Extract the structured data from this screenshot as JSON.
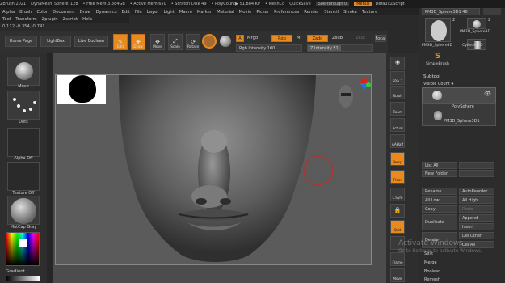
{
  "titlebar": {
    "app": "ZBrush 2021",
    "doc": "DynaMesh_Sphere_128",
    "free_mem": "• Free Mem 3.384GB",
    "active_mem": "• Active Mem 650",
    "scratch": "• Scratch Disk 49",
    "timer": "• PolyCount▶ 51.884 KP",
    "meshcount": "• MeshCo",
    "quicksave": "QuickSave",
    "see_through": "See-through  0",
    "menus": "Menus",
    "script": "DefaultZScript"
  },
  "menu": [
    "Alpha",
    "Brush",
    "Color",
    "Document",
    "Draw",
    "Dynamics",
    "Edit",
    "File",
    "Layer",
    "Light",
    "Macro",
    "Marker",
    "Material",
    "Movie",
    "Picker",
    "Preferences",
    "Render",
    "Stencil",
    "Stroke",
    "Texture"
  ],
  "menu2": [
    "Tool",
    "Transform",
    "Zplugin",
    "Zscript",
    "Help"
  ],
  "coords": "0.112,-0.354,-0.741",
  "shelf": {
    "home_page": "Home Page",
    "lightbox": "LightBox",
    "live_boolean": "Live Boolean",
    "edit": "Edit",
    "draw": "Draw",
    "move": "Move",
    "scale": "Scale",
    "rotate": "Rotate",
    "a_btn": "A",
    "mrgb": "Mrgb",
    "rgb": "Rgb",
    "m": "M",
    "zadd": "Zadd",
    "zsub": "Zsub",
    "zcut": "Zcut",
    "rgb_intensity": "Rgb Intensity 100",
    "z_intensity": "Z Intensity 51",
    "focal": "Focal"
  },
  "left": {
    "move": "Move",
    "dots": "Dots",
    "alpha_off": "Alpha Off",
    "texture_off": "Texture Off",
    "matcap": "MatCap Gray",
    "gradient": "Gradient"
  },
  "right": [
    "SPix 3",
    "Scroll",
    "Zoom",
    "Actual",
    "AAHalf",
    "Persp",
    "Floor",
    "L.Sym",
    "",
    "Qrid",
    "",
    "",
    "Frame",
    "Move"
  ],
  "panel": {
    "tool_name": "PM3D_Sphere3D1  48",
    "ts1": "PM3D_Sphere3D",
    "ts2": "PM3D_Sphere3D",
    "ts3": "Cylinder3D",
    "ts4": "SimpleBrush",
    "num1": "2",
    "num2": "2",
    "subtool": "Subtool",
    "visible_count": "Visible Count 4",
    "polysphere": "PolySphere",
    "pm3d": "PM3D_Sphere3D1",
    "list_all": "List All",
    "new_folder": "New Folder",
    "rename": "Rename",
    "autoreorder": "AutoReorder",
    "all_low": "All Low",
    "all_high": "All High",
    "copy": "Copy",
    "paste": "Paste",
    "duplicate": "Duplicate",
    "append": "Append",
    "insert": "Insert",
    "del_other": "Del Other",
    "delete": "Delete",
    "del_all": "Del All",
    "split": "Split",
    "merge": "Merge",
    "boolean": "Boolean",
    "remesh": "Remesh"
  },
  "watermark": {
    "line1": "Activate Windows",
    "line2": "Go to Settings to activate Windows."
  },
  "colors": {
    "accent": "#e98a1f",
    "bg": "#2a2a2a",
    "canvas": "#5b5b5b"
  }
}
